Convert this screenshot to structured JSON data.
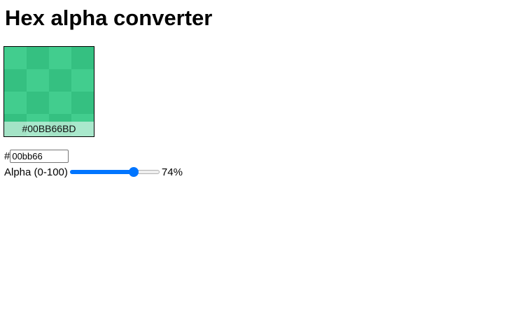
{
  "title": "Hex alpha converter",
  "swatch": {
    "label": "#00BB66BD",
    "color": "#00BB66",
    "alpha": 0.74
  },
  "hex_field": {
    "prefix": "#",
    "value": "00bb66"
  },
  "alpha_control": {
    "label": "Alpha (0-100)",
    "value": 74,
    "min": 0,
    "max": 100,
    "display": "74%",
    "accent_color": "#0075FF"
  }
}
